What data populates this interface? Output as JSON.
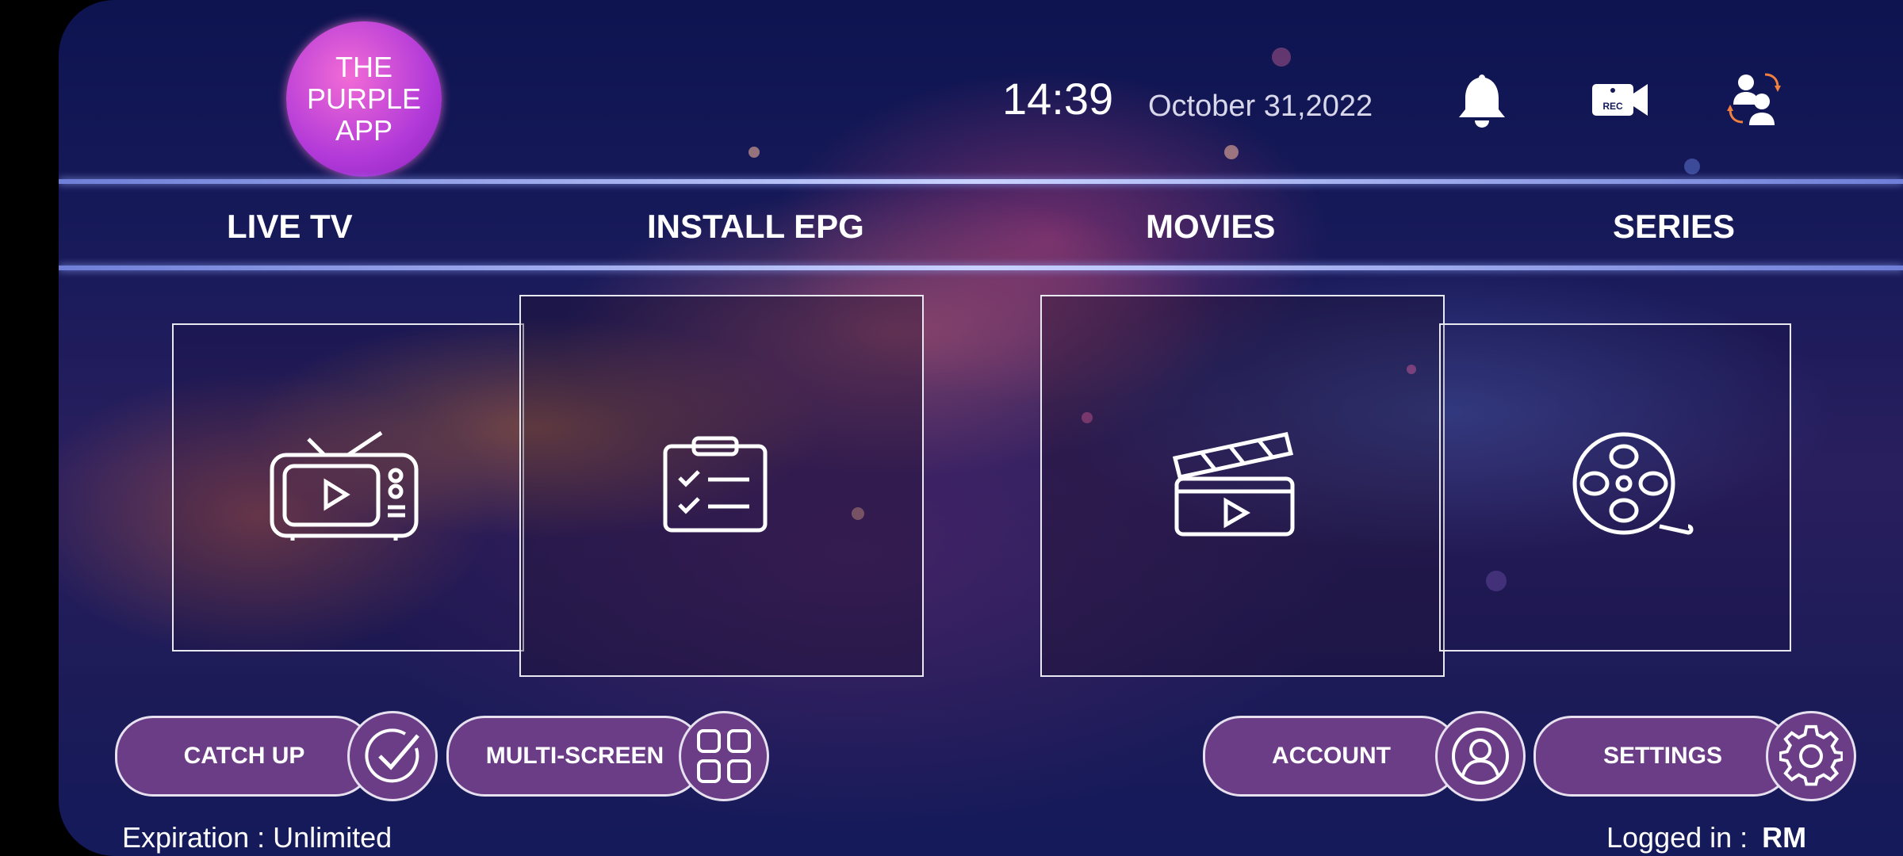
{
  "app": {
    "logo_lines": [
      "THE",
      "PURPLE",
      "APP"
    ]
  },
  "header": {
    "time": "14:39",
    "date": "October 31,2022",
    "icons": [
      "bell-icon",
      "rec-camera-icon",
      "switch-user-icon"
    ],
    "rec_text": "REC"
  },
  "nav": {
    "items": [
      {
        "label": "LIVE TV"
      },
      {
        "label": "INSTALL EPG"
      },
      {
        "label": "MOVIES"
      },
      {
        "label": "SERIES"
      }
    ]
  },
  "tiles": [
    "tv-icon",
    "clipboard-checklist-icon",
    "clapperboard-icon",
    "film-reel-icon"
  ],
  "actions": [
    {
      "label": "CATCH UP",
      "icon": "check-circle-icon"
    },
    {
      "label": "MULTI-SCREEN",
      "icon": "grid-icon"
    },
    {
      "label": "ACCOUNT",
      "icon": "user-icon"
    },
    {
      "label": "SETTINGS",
      "icon": "gear-icon"
    }
  ],
  "footer": {
    "expiration": "Expiration : Unlimited",
    "logged_in_label": "Logged in :",
    "user": "RM"
  },
  "colors": {
    "accent": "#6a3d86",
    "logo": "#c44ad8",
    "bg": "#141a5a"
  }
}
